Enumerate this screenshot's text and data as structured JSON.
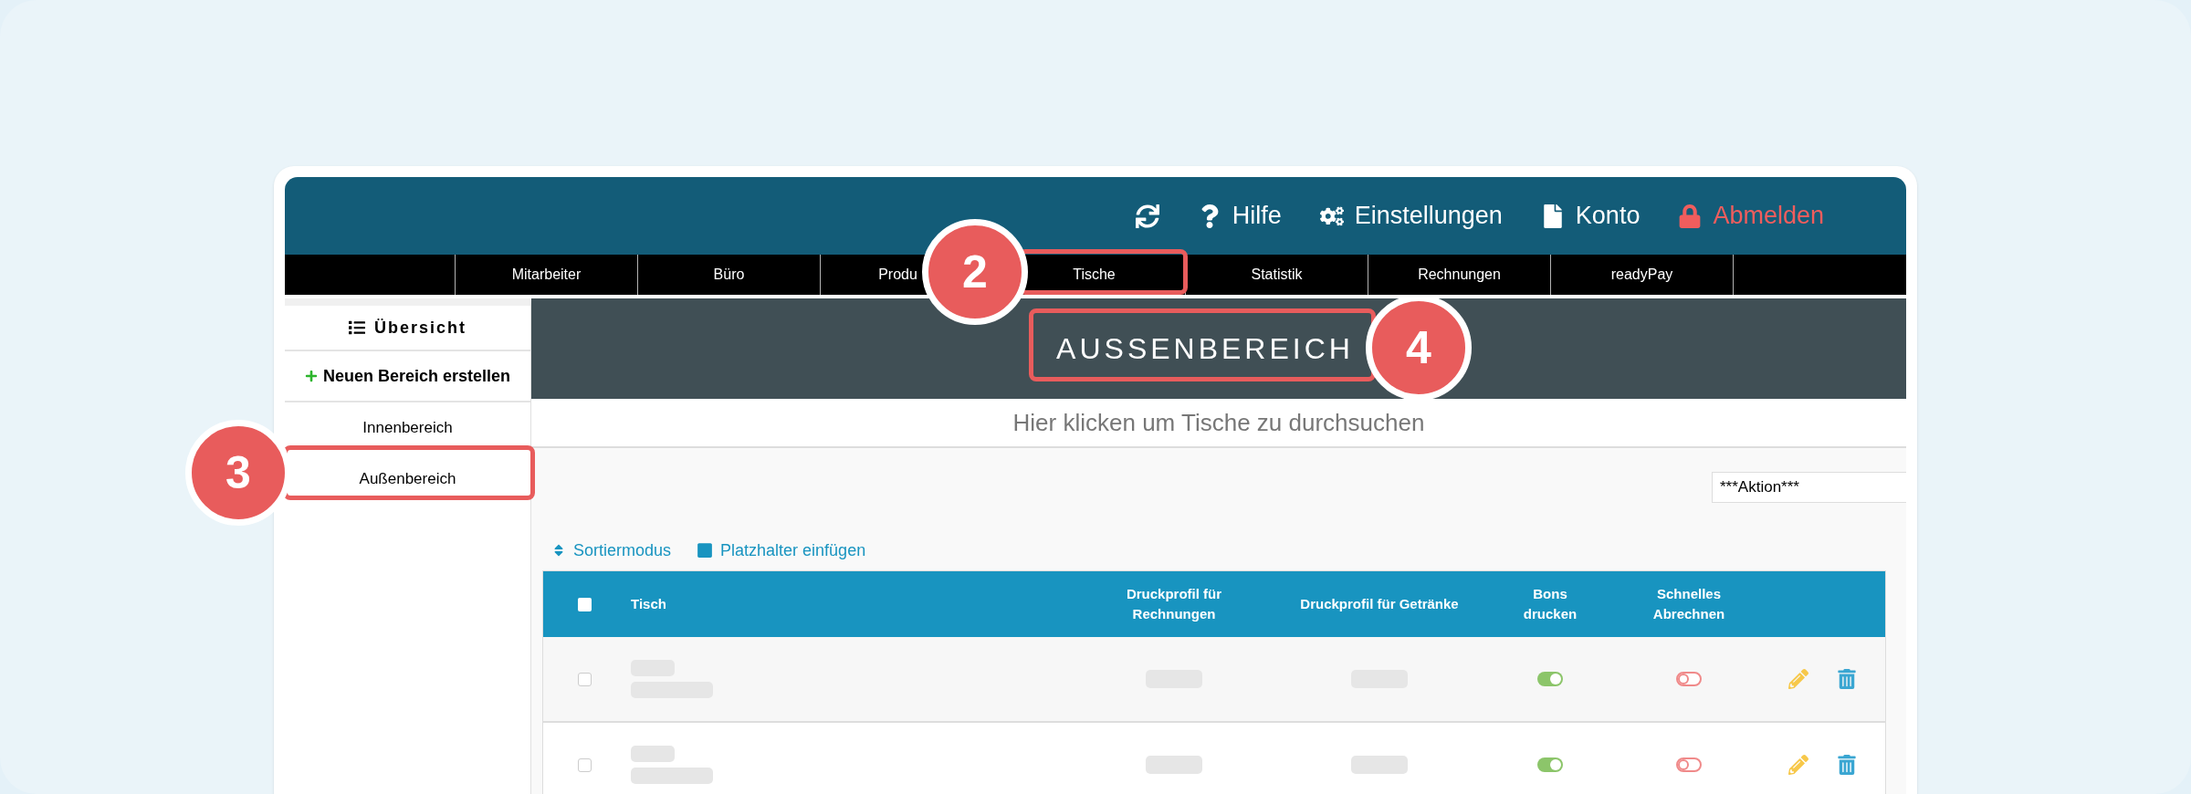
{
  "header_actions": [
    {
      "kind": "refresh"
    },
    {
      "kind": "help",
      "label": "Hilfe"
    },
    {
      "kind": "settings",
      "label": "Einstellungen"
    },
    {
      "kind": "account",
      "label": "Konto"
    },
    {
      "kind": "logout",
      "label": "Abmelden"
    }
  ],
  "nav": [
    "Mitarbeiter",
    "Büro",
    "Produ",
    "Tische",
    "Statistik",
    "Rechnungen",
    "readyPay"
  ],
  "sidebar": {
    "overview": "Übersicht",
    "create": "Neuen Bereich erstellen",
    "areas": [
      "Innenbereich",
      "Außenbereich"
    ]
  },
  "title": "AUSSENBEREICH",
  "search": {
    "placeholder": "Hier klicken um Tische zu durchsuchen"
  },
  "action_select": "***Aktion***",
  "toolbar": [
    {
      "kind": "sort",
      "label": "Sortiermodus"
    },
    {
      "kind": "placeholder",
      "label": "Platzhalter einfügen"
    }
  ],
  "table": {
    "select_all_checked": false,
    "columns": [
      "Tisch",
      "Druckprofil für Rechnungen",
      "Druckprofil für Getränke",
      "Bons drucken",
      "Schnelles Abrechnen"
    ],
    "rows": [
      {
        "checked": false,
        "bons_drucken": true,
        "schnelles_abrechnen": false
      },
      {
        "checked": false,
        "bons_drucken": true,
        "schnelles_abrechnen": false
      }
    ]
  },
  "callouts": [
    {
      "number": "2",
      "kind": "nav"
    },
    {
      "number": "3",
      "kind": "sidebar"
    },
    {
      "number": "4",
      "kind": "title"
    }
  ]
}
